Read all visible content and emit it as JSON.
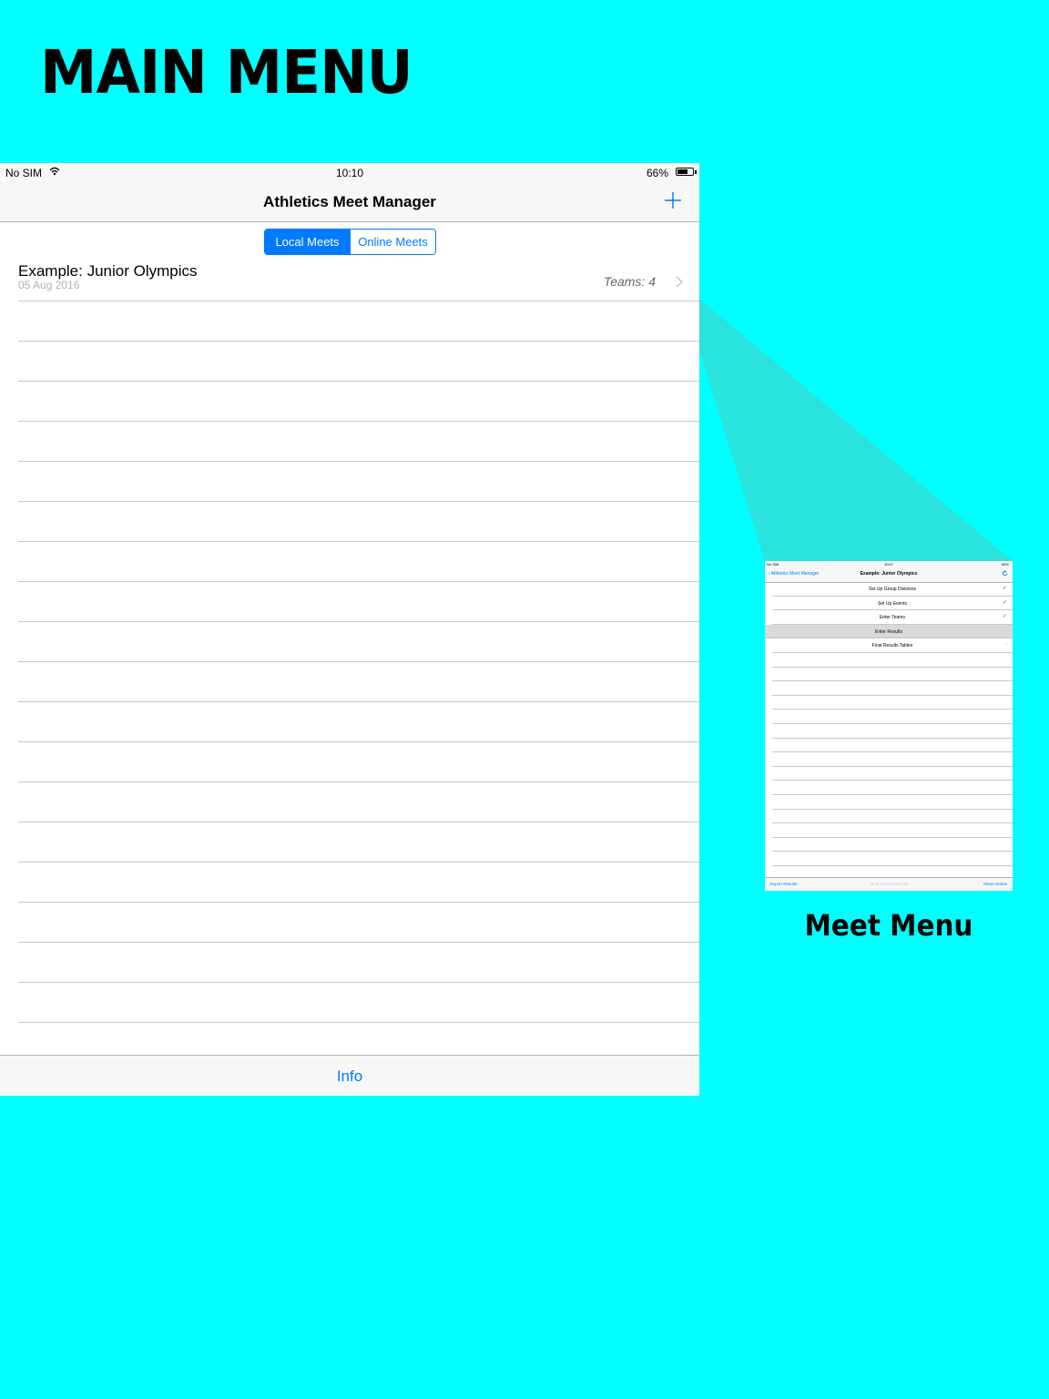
{
  "page": {
    "headline": "MAIN MENU",
    "caption": "Meet Menu",
    "background_color": "#00ffff"
  },
  "main_screen": {
    "status": {
      "carrier": "No SIM",
      "time": "10:10",
      "battery": "66%",
      "battery_level": 0.66
    },
    "nav": {
      "title": "Athletics Meet Manager",
      "add_icon": "plus-icon"
    },
    "segments": {
      "local": "Local Meets",
      "online": "Online Meets",
      "selected": "Local Meets"
    },
    "meets": [
      {
        "title": "Example: Junior Olympics",
        "date": "05 Aug 2016",
        "teams": "Teams: 4"
      }
    ],
    "empty_rows": 19,
    "toolbar": {
      "info": "Info"
    },
    "accent_color": "#007aff"
  },
  "thumbnail": {
    "status": {
      "carrier": "No SIM",
      "time": "10:07",
      "battery": "66%"
    },
    "nav": {
      "back": "Athletics Meet Manager",
      "title": "Example: Junior Olympics",
      "refresh_icon": "refresh-icon"
    },
    "items": [
      {
        "label": "Set Up Group Divisions",
        "state": "check"
      },
      {
        "label": "Set Up Events",
        "state": "check"
      },
      {
        "label": "Enter Teams",
        "state": "check"
      },
      {
        "label": "Enter Results",
        "state": "selected"
      },
      {
        "label": "Final Results Tables",
        "state": "chevron"
      }
    ],
    "toolbar": {
      "left": "Export Results",
      "middle": "Send Permission File",
      "right": "Share Online"
    }
  }
}
